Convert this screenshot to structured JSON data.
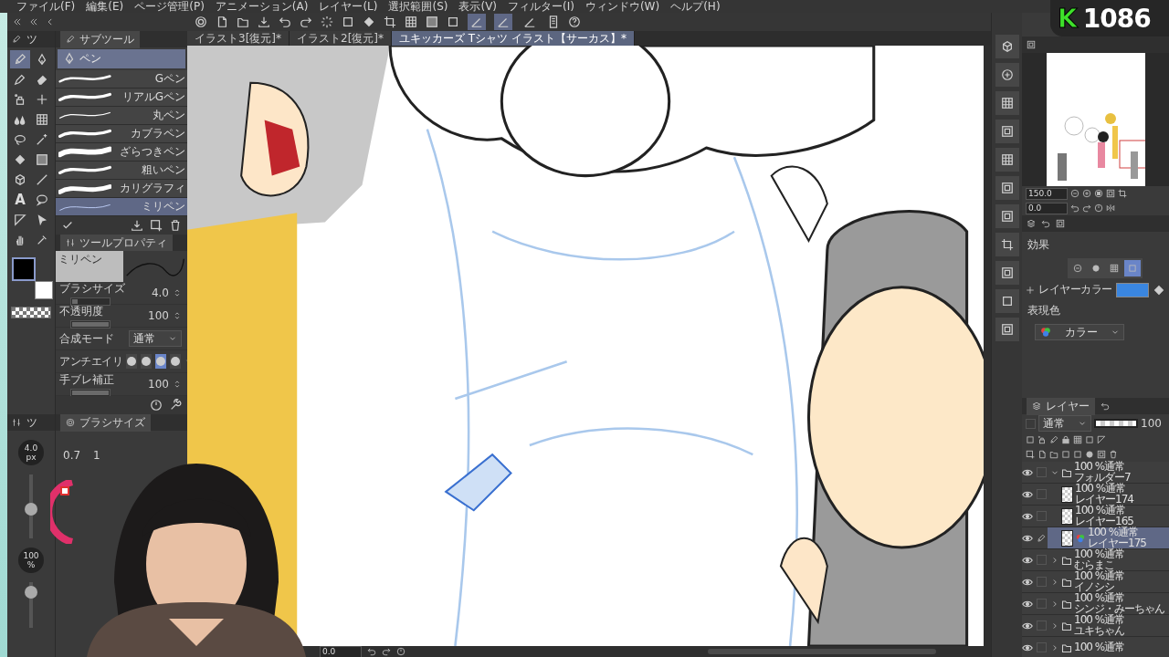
{
  "menu": [
    "ファイル(F)",
    "編集(E)",
    "ページ管理(P)",
    "アニメーション(A)",
    "レイヤー(L)",
    "選択範囲(S)",
    "表示(V)",
    "フィルター(I)",
    "ウィンドウ(W)",
    "ヘルプ(H)"
  ],
  "stream_badge": {
    "letter": "K",
    "count": "1086"
  },
  "toolbar": {
    "toggles": [
      {
        "on": true
      },
      {
        "on": true
      },
      {
        "on": false
      }
    ]
  },
  "document_tabs": [
    {
      "label": "イラスト3[復元]*",
      "selected": false
    },
    {
      "label": "イラスト2[復元]*",
      "selected": false
    },
    {
      "label": "ユキッカーズ Tシャツ イラスト【サーカス】*",
      "selected": true
    }
  ],
  "tool_panel": {
    "tab": "ツ",
    "tools": [
      {
        "selected": true
      },
      {
        "selected": false
      },
      {
        "selected": false
      },
      {
        "selected": false
      },
      {
        "selected": false
      },
      {
        "selected": false
      },
      {
        "selected": false
      },
      {
        "selected": false
      },
      {
        "selected": false
      },
      {
        "selected": false
      },
      {
        "selected": false
      },
      {
        "selected": false
      },
      {
        "selected": false
      },
      {
        "selected": false
      },
      {
        "glyph": "A",
        "selected": false
      },
      {
        "selected": false
      },
      {
        "selected": false
      },
      {
        "selected": false
      },
      {
        "selected": false
      },
      {
        "selected": false
      }
    ]
  },
  "subtool_panel": {
    "tab": "サブツール",
    "group": "ペン",
    "brushes": [
      {
        "name": "Gペン",
        "selected": false
      },
      {
        "name": "リアルGペン",
        "selected": false
      },
      {
        "name": "丸ペン",
        "selected": false
      },
      {
        "name": "カブラペン",
        "selected": false
      },
      {
        "name": "ざらつきペン",
        "selected": false
      },
      {
        "name": "粗いペン",
        "selected": false
      },
      {
        "name": "カリグラフィ",
        "selected": false
      },
      {
        "name": "ミリペン",
        "selected": true
      }
    ]
  },
  "tool_property": {
    "tab": "ツールプロパティ",
    "preview_label": "ミリペン",
    "rows": [
      {
        "kind": "slider",
        "label": "ブラシサイズ",
        "value": "4.0",
        "level": 0.15
      },
      {
        "kind": "slider",
        "label": "不透明度",
        "value": "100",
        "level": 1
      },
      {
        "kind": "select",
        "label": "合成モード",
        "value": "通常"
      },
      {
        "kind": "antialias",
        "label": "アンチエイリ",
        "options": [
          {
            "selected": false
          },
          {
            "selected": false
          },
          {
            "selected": true
          },
          {
            "selected": false
          }
        ]
      },
      {
        "kind": "slider",
        "label": "手ブレ補正",
        "value": "100",
        "level": 1
      }
    ]
  },
  "size_panel": {
    "tab": "ツ",
    "size": "4.0",
    "size_unit": "px",
    "size_slider": {
      "level": 0.45
    },
    "opacity": "100",
    "opacity_unit": "%",
    "opacity_slider": {
      "level": 0.9
    }
  },
  "brush_size_panel": {
    "tab": "ブラシサイズ",
    "sizes": [
      "0.7",
      "1"
    ]
  },
  "canvas_footer": {
    "rotation": "0.0"
  },
  "navigator": {
    "zoom": "150.0",
    "rotation": "0.0"
  },
  "layer_property": {
    "effect_label": "効果",
    "effects": [
      {
        "on": false
      },
      {
        "on": false
      },
      {
        "on": false
      },
      {
        "on": true
      }
    ],
    "layer_color_label": "レイヤーカラー",
    "layer_color_swatch": {
      "color": "#3a86e0"
    },
    "expression_label": "表現色",
    "expression_value": "カラー"
  },
  "layers_panel": {
    "tab": "レイヤー",
    "blend_mode": "通常",
    "opacity_slider": {
      "level": 1
    },
    "opacity": "100",
    "layers": [
      {
        "kind": "folder",
        "mode": "100 %通常",
        "name": "フォルダー7",
        "expanded": true,
        "selected": false,
        "children": [
          {
            "kind": "layer",
            "mode": "100 %通常",
            "name": "レイヤー174",
            "selected": false
          },
          {
            "kind": "layer",
            "mode": "100 %通常",
            "name": "レイヤー165",
            "selected": false
          },
          {
            "kind": "layer",
            "mode": "100 %通常",
            "name": "レイヤー175",
            "selected": true
          }
        ]
      },
      {
        "kind": "folder",
        "mode": "100 %通常",
        "name": "むらまこ",
        "expanded": false,
        "selected": false
      },
      {
        "kind": "folder",
        "mode": "100 %通常",
        "name": "イノシシ",
        "expanded": false,
        "selected": false
      },
      {
        "kind": "folder",
        "mode": "100 %通常",
        "name": "シンジ・みーちゃん",
        "expanded": false,
        "selected": false
      },
      {
        "kind": "folder",
        "mode": "100 %通常",
        "name": "ユキちゃん",
        "expanded": false,
        "selected": false
      },
      {
        "kind": "folder",
        "mode": "100 %通常",
        "expanded": false,
        "selected": false
      }
    ]
  }
}
